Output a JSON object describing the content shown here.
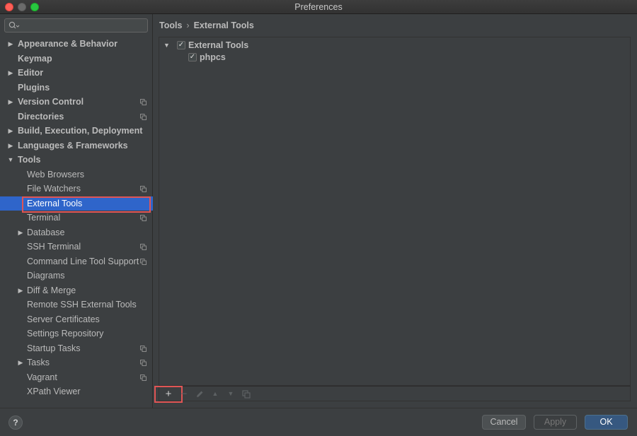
{
  "window": {
    "title": "Preferences"
  },
  "sidebar": {
    "search_placeholder": "",
    "items": [
      {
        "label": "Appearance & Behavior",
        "level": 0,
        "expandable": true,
        "expanded": false,
        "bold": true,
        "copy_icon": false
      },
      {
        "label": "Keymap",
        "level": 0,
        "expandable": false,
        "bold": true,
        "copy_icon": false
      },
      {
        "label": "Editor",
        "level": 0,
        "expandable": true,
        "expanded": false,
        "bold": true,
        "copy_icon": false
      },
      {
        "label": "Plugins",
        "level": 0,
        "expandable": false,
        "bold": true,
        "copy_icon": false
      },
      {
        "label": "Version Control",
        "level": 0,
        "expandable": true,
        "expanded": false,
        "bold": true,
        "copy_icon": true
      },
      {
        "label": "Directories",
        "level": 0,
        "expandable": false,
        "bold": true,
        "copy_icon": true
      },
      {
        "label": "Build, Execution, Deployment",
        "level": 0,
        "expandable": true,
        "expanded": false,
        "bold": true,
        "copy_icon": false
      },
      {
        "label": "Languages & Frameworks",
        "level": 0,
        "expandable": true,
        "expanded": false,
        "bold": true,
        "copy_icon": false
      },
      {
        "label": "Tools",
        "level": 0,
        "expandable": true,
        "expanded": true,
        "bold": true,
        "copy_icon": false
      },
      {
        "label": "Web Browsers",
        "level": 1,
        "expandable": false,
        "copy_icon": false
      },
      {
        "label": "File Watchers",
        "level": 1,
        "expandable": false,
        "copy_icon": true
      },
      {
        "label": "External Tools",
        "level": 1,
        "expandable": false,
        "copy_icon": false,
        "selected": true
      },
      {
        "label": "Terminal",
        "level": 1,
        "expandable": false,
        "copy_icon": true
      },
      {
        "label": "Database",
        "level": 1,
        "expandable": true,
        "expanded": false,
        "copy_icon": false
      },
      {
        "label": "SSH Terminal",
        "level": 1,
        "expandable": false,
        "copy_icon": true
      },
      {
        "label": "Command Line Tool Support",
        "level": 1,
        "expandable": false,
        "copy_icon": true
      },
      {
        "label": "Diagrams",
        "level": 1,
        "expandable": false,
        "copy_icon": false
      },
      {
        "label": "Diff & Merge",
        "level": 1,
        "expandable": true,
        "expanded": false,
        "copy_icon": false
      },
      {
        "label": "Remote SSH External Tools",
        "level": 1,
        "expandable": false,
        "copy_icon": false
      },
      {
        "label": "Server Certificates",
        "level": 1,
        "expandable": false,
        "copy_icon": false
      },
      {
        "label": "Settings Repository",
        "level": 1,
        "expandable": false,
        "copy_icon": false
      },
      {
        "label": "Startup Tasks",
        "level": 1,
        "expandable": false,
        "copy_icon": true
      },
      {
        "label": "Tasks",
        "level": 1,
        "expandable": true,
        "expanded": false,
        "copy_icon": true
      },
      {
        "label": "Vagrant",
        "level": 1,
        "expandable": false,
        "copy_icon": true
      },
      {
        "label": "XPath Viewer",
        "level": 1,
        "expandable": false,
        "copy_icon": false
      }
    ]
  },
  "breadcrumb": {
    "parent": "Tools",
    "separator": "›",
    "current": "External Tools"
  },
  "tools_tree": {
    "group": {
      "label": "External Tools",
      "checked": true,
      "expanded": true
    },
    "children": [
      {
        "label": "phpcs",
        "checked": true
      }
    ]
  },
  "toolbar": {
    "add": "+",
    "remove": "−",
    "edit": "edit-icon",
    "move_up": "▲",
    "move_down": "▼",
    "copy": "copy-icon"
  },
  "footer": {
    "help": "?",
    "cancel": "Cancel",
    "apply": "Apply",
    "ok": "OK"
  },
  "colors": {
    "selection": "#2f65ca",
    "highlight": "#e05555",
    "ok_button": "#365880"
  }
}
